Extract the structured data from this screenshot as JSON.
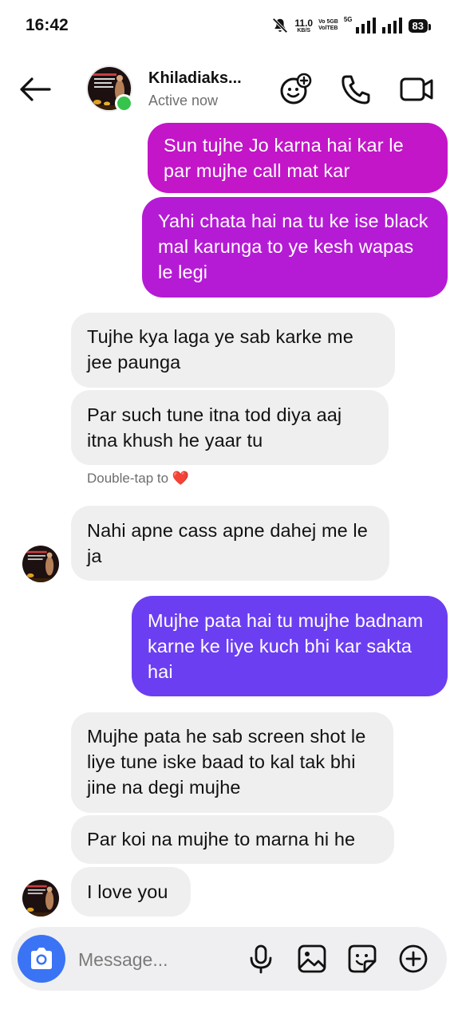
{
  "status_bar": {
    "time": "16:42",
    "net_speed": "11.0",
    "net_speed_unit": "KB/S",
    "volte_top": "Vo 5GB",
    "volte_bottom": "VolTEB",
    "signal_5g": "5G",
    "battery": "83"
  },
  "header": {
    "contact_name": "Khiladiaks...",
    "status": "Active now",
    "icons": [
      "back-arrow-icon",
      "add-effects-icon",
      "phone-icon",
      "video-camera-icon"
    ],
    "online_color": "#36c44c"
  },
  "messages": [
    {
      "from": "me",
      "text": "Sun tujhe Jo karna hai kar le par mujhe call mat kar",
      "color": "#c216c8"
    },
    {
      "from": "me",
      "text": "Yahi chata hai na tu ke ise black mal karunga to ye kesh wapas le legi",
      "color": "#b51bd5"
    },
    {
      "from": "them",
      "text": "Tujhe kya laga ye sab karke me jee paunga"
    },
    {
      "from": "them",
      "text": "Par such tune itna tod diya aaj itna khush he yaar tu"
    },
    {
      "from": "them",
      "text": "Nahi apne cass apne dahej me le ja"
    },
    {
      "from": "me",
      "text": "Mujhe pata hai tu mujhe badnam karne ke liye kuch bhi kar sakta hai",
      "color": "#6c3ef2"
    },
    {
      "from": "them",
      "text": "Mujhe pata he sab screen shot le liye tune iske baad to kal tak bhi jine na degi mujhe"
    },
    {
      "from": "them",
      "text": "Par koi na mujhe to marna hi he"
    },
    {
      "from": "them",
      "text": "I love you"
    }
  ],
  "reaction_hint": "Double-tap to",
  "reaction_hint_emoji": "❤️",
  "composer": {
    "placeholder": "Message...",
    "camera_color": "#3b73f5",
    "icons": [
      "camera-icon",
      "microphone-icon",
      "gallery-icon",
      "sticker-icon",
      "plus-icon"
    ]
  }
}
